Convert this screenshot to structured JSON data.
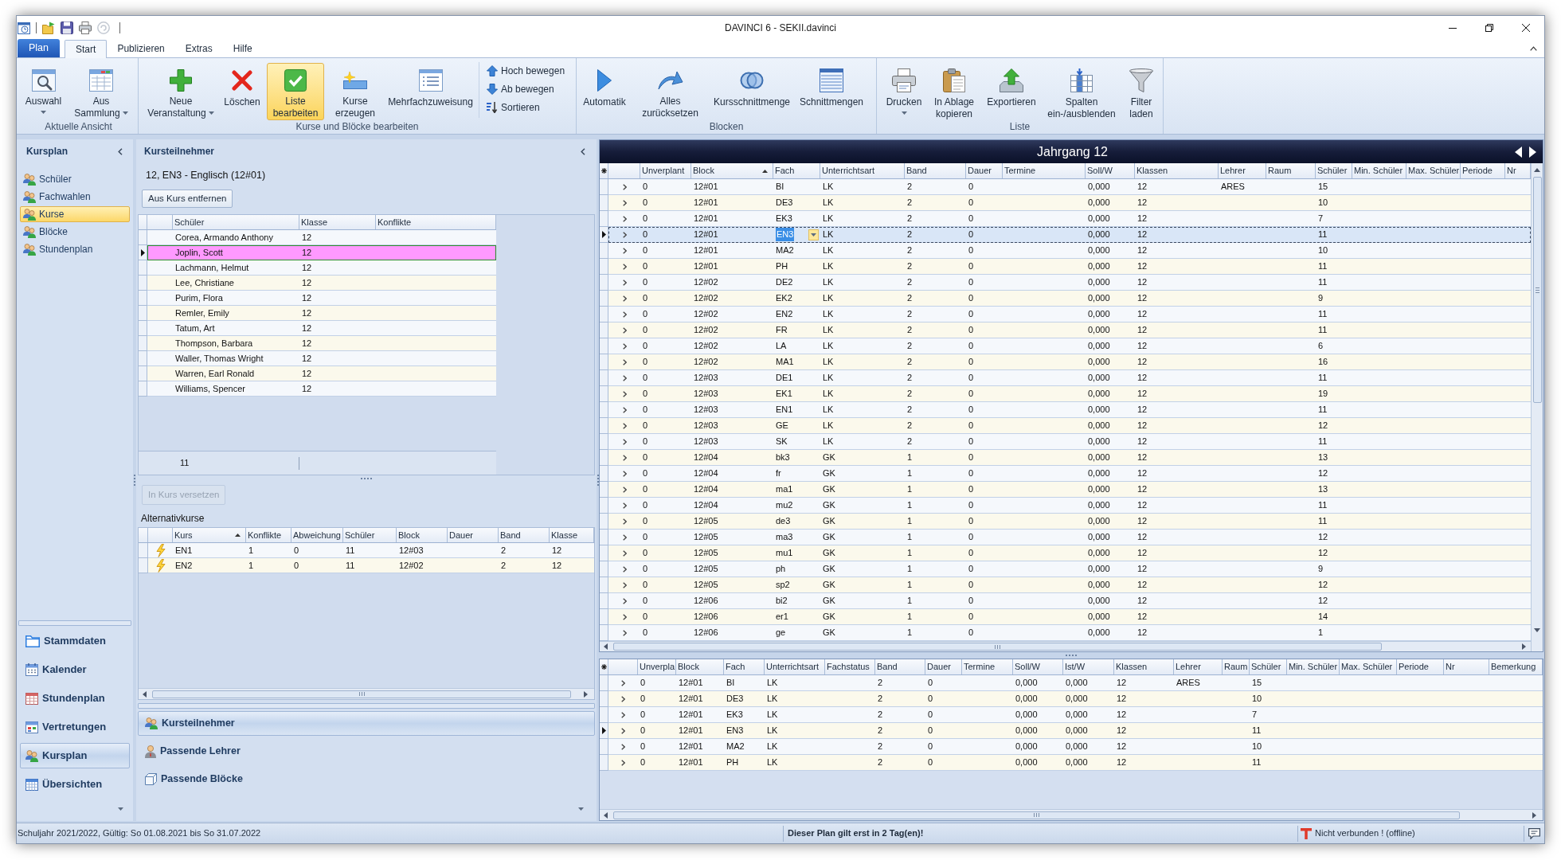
{
  "window": {
    "title": "DAVINCI 6 - SEKII.davinci"
  },
  "ribbon_tabs": [
    {
      "label": "Plan",
      "kind": "application",
      "selected": false
    },
    {
      "label": "Start",
      "kind": "tab",
      "selected": true
    },
    {
      "label": "Publizieren",
      "kind": "tab",
      "selected": false
    },
    {
      "label": "Extras",
      "kind": "tab",
      "selected": false
    },
    {
      "label": "Hilfe",
      "kind": "tab",
      "selected": false
    }
  ],
  "ribbon_groups": [
    {
      "label": "Aktuelle Ansicht",
      "buttons": [
        {
          "kind": "large",
          "lines": [
            "Auswahl"
          ],
          "dropdown": true,
          "pressed": false
        },
        {
          "kind": "large",
          "lines": [
            "Aus",
            "Sammlung"
          ],
          "dropdown": true,
          "pressed": false
        }
      ]
    },
    {
      "label": "Kurse und Blöcke bearbeiten",
      "buttons": [
        {
          "kind": "large",
          "lines": [
            "Neue",
            "Veranstaltung"
          ],
          "dropdown": true,
          "pressed": false
        },
        {
          "kind": "large",
          "lines": [
            "Löschen"
          ],
          "dropdown": false,
          "pressed": false
        },
        {
          "kind": "large",
          "lines": [
            "Liste",
            "bearbeiten"
          ],
          "dropdown": false,
          "pressed": true
        },
        {
          "kind": "large",
          "lines": [
            "Kurse",
            "erzeugen"
          ],
          "dropdown": false,
          "pressed": false
        },
        {
          "kind": "large",
          "lines": [
            "Mehrfachzuweisung"
          ],
          "dropdown": false,
          "pressed": false
        },
        {
          "kind": "small",
          "lines": [
            "Hoch bewegen"
          ],
          "dropdown": false,
          "pressed": false
        },
        {
          "kind": "small",
          "lines": [
            "Ab bewegen"
          ],
          "dropdown": false,
          "pressed": false
        },
        {
          "kind": "small",
          "lines": [
            "Sortieren"
          ],
          "dropdown": false,
          "pressed": false
        }
      ]
    },
    {
      "label": "Blocken",
      "buttons": [
        {
          "kind": "large",
          "lines": [
            "Automatik"
          ],
          "dropdown": false,
          "pressed": false
        },
        {
          "kind": "large",
          "lines": [
            "Alles",
            "zurücksetzen"
          ],
          "dropdown": false,
          "pressed": false
        },
        {
          "kind": "large",
          "lines": [
            "Kursschnittmenge"
          ],
          "dropdown": false,
          "pressed": false
        },
        {
          "kind": "large",
          "lines": [
            "Schnittmengen"
          ],
          "dropdown": false,
          "pressed": false
        }
      ]
    },
    {
      "label": "Liste",
      "buttons": [
        {
          "kind": "large",
          "lines": [
            "Drucken"
          ],
          "dropdown": true,
          "pressed": false
        },
        {
          "kind": "large",
          "lines": [
            "In Ablage",
            "kopieren"
          ],
          "dropdown": false,
          "pressed": false
        },
        {
          "kind": "large",
          "lines": [
            "Exportieren"
          ],
          "dropdown": false,
          "pressed": false
        },
        {
          "kind": "large",
          "lines": [
            "Spalten",
            "ein-/ausblenden"
          ],
          "dropdown": false,
          "pressed": false
        },
        {
          "kind": "large",
          "lines": [
            "Filter",
            "laden"
          ],
          "dropdown": false,
          "pressed": false
        }
      ]
    }
  ],
  "navigator": {
    "title": "Kursplan",
    "items": [
      {
        "label": "Schüler",
        "selected": false
      },
      {
        "label": "Fachwahlen",
        "selected": false
      },
      {
        "label": "Kurse",
        "selected": true
      },
      {
        "label": "Blöcke",
        "selected": false
      },
      {
        "label": "Stundenplan",
        "selected": false
      }
    ]
  },
  "modules": [
    {
      "label": "Stammdaten",
      "selected": false
    },
    {
      "label": "Kalender",
      "selected": false
    },
    {
      "label": "Stundenplan",
      "selected": false
    },
    {
      "label": "Vertretungen",
      "selected": false
    },
    {
      "label": "Kursplan",
      "selected": true
    },
    {
      "label": "Übersichten",
      "selected": false
    }
  ],
  "participants_panel": {
    "title": "Kursteilnehmer",
    "course": "12, EN3 - Englisch (12#01)",
    "remove_button": {
      "label": "Aus Kurs entfernen",
      "disabled": false
    },
    "table": {
      "columns": [
        {
          "label": "Schüler"
        },
        {
          "label": "Klasse"
        },
        {
          "label": "Konflikte"
        }
      ],
      "rows": [
        {
          "schueler": "Corea, Armando Anthony",
          "klasse": "12",
          "selected": false
        },
        {
          "schueler": "Joplin, Scott",
          "klasse": "12",
          "selected": true
        },
        {
          "schueler": "Lachmann, Helmut",
          "klasse": "12",
          "selected": false
        },
        {
          "schueler": "Lee, Christiane",
          "klasse": "12",
          "selected": false
        },
        {
          "schueler": "Purim, Flora",
          "klasse": "12",
          "selected": false
        },
        {
          "schueler": "Remler, Emily",
          "klasse": "12",
          "selected": false
        },
        {
          "schueler": "Tatum, Art",
          "klasse": "12",
          "selected": false
        },
        {
          "schueler": "Thompson, Barbara",
          "klasse": "12",
          "selected": false
        },
        {
          "schueler": "Waller, Thomas Wright",
          "klasse": "12",
          "selected": false
        },
        {
          "schueler": "Warren, Earl Ronald",
          "klasse": "12",
          "selected": false
        },
        {
          "schueler": "Williams, Spencer",
          "klasse": "12",
          "selected": false
        }
      ],
      "footer": "11"
    },
    "move_button": {
      "label": "In Kurs versetzen",
      "disabled": true
    },
    "alternatives": {
      "title": "Alternativkurse",
      "columns": [
        {
          "label": "Kurs",
          "sorted": true
        },
        {
          "label": "Konflikte",
          "sorted": false
        },
        {
          "label": "Abweichung",
          "sorted": false
        },
        {
          "label": "Schüler",
          "sorted": false
        },
        {
          "label": "Block",
          "sorted": false
        },
        {
          "label": "Dauer",
          "sorted": false
        },
        {
          "label": "Band",
          "sorted": false
        },
        {
          "label": "Klasse",
          "sorted": false
        }
      ],
      "rows": [
        {
          "kurs": "EN1",
          "konflikte": "1",
          "abweichung": "0",
          "schueler": "11",
          "block": "12#03",
          "band": "2",
          "klasse": "12",
          "selected": false
        },
        {
          "kurs": "EN2",
          "konflikte": "1",
          "abweichung": "0",
          "schueler": "11",
          "block": "12#02",
          "band": "2",
          "klasse": "12",
          "selected": false
        }
      ]
    },
    "views": [
      {
        "label": "Kursteilnehmer",
        "selected": true
      },
      {
        "label": "Passende Lehrer",
        "selected": false
      },
      {
        "label": "Passende Blöcke",
        "selected": false
      }
    ]
  },
  "course_grid": {
    "title": "Jahrgang 12",
    "columns": [
      {
        "label": "Unverplant",
        "sorted": false
      },
      {
        "label": "Block",
        "sorted": true
      },
      {
        "label": "Fach",
        "sorted": false
      },
      {
        "label": "Unterrichtsart",
        "sorted": false
      },
      {
        "label": "Band",
        "sorted": false
      },
      {
        "label": "Dauer",
        "sorted": false
      },
      {
        "label": "Termine",
        "sorted": false
      },
      {
        "label": "Soll/W",
        "sorted": false
      },
      {
        "label": "Klassen",
        "sorted": false
      },
      {
        "label": "Lehrer",
        "sorted": false
      },
      {
        "label": "Raum",
        "sorted": false
      },
      {
        "label": "Schüler",
        "sorted": false
      },
      {
        "label": "Min. Schüler",
        "sorted": false
      },
      {
        "label": "Max. Schüler",
        "sorted": false
      },
      {
        "label": "Periode",
        "sorted": false
      },
      {
        "label": "Nr",
        "sorted": false
      }
    ],
    "rows": [
      {
        "unverplant": "0",
        "block": "12#01",
        "fach": "BI",
        "unterrichtsart": "LK",
        "band": "2",
        "dauer": "0",
        "soll_w": "0,000",
        "klassen": "12",
        "lehrer": "ARES",
        "schueler": "15",
        "expanded": false,
        "selected": false
      },
      {
        "unverplant": "0",
        "block": "12#01",
        "fach": "DE3",
        "unterrichtsart": "LK",
        "band": "2",
        "dauer": "0",
        "soll_w": "0,000",
        "klassen": "12",
        "schueler": "10",
        "expanded": false,
        "selected": false
      },
      {
        "unverplant": "0",
        "block": "12#01",
        "fach": "EK3",
        "unterrichtsart": "LK",
        "band": "2",
        "dauer": "0",
        "soll_w": "0,000",
        "klassen": "12",
        "schueler": "7",
        "expanded": false,
        "selected": false
      },
      {
        "unverplant": "0",
        "block": "12#01",
        "fach": "EN3",
        "unterrichtsart": "LK",
        "band": "2",
        "dauer": "0",
        "soll_w": "0,000",
        "klassen": "12",
        "schueler": "11",
        "expanded": false,
        "selected": true
      },
      {
        "unverplant": "0",
        "block": "12#01",
        "fach": "MA2",
        "unterrichtsart": "LK",
        "band": "2",
        "dauer": "0",
        "soll_w": "0,000",
        "klassen": "12",
        "schueler": "10",
        "expanded": false,
        "selected": false
      },
      {
        "unverplant": "0",
        "block": "12#01",
        "fach": "PH",
        "unterrichtsart": "LK",
        "band": "2",
        "dauer": "0",
        "soll_w": "0,000",
        "klassen": "12",
        "schueler": "11",
        "expanded": false,
        "selected": false
      },
      {
        "unverplant": "0",
        "block": "12#02",
        "fach": "DE2",
        "unterrichtsart": "LK",
        "band": "2",
        "dauer": "0",
        "soll_w": "0,000",
        "klassen": "12",
        "schueler": "11",
        "expanded": false,
        "selected": false
      },
      {
        "unverplant": "0",
        "block": "12#02",
        "fach": "EK2",
        "unterrichtsart": "LK",
        "band": "2",
        "dauer": "0",
        "soll_w": "0,000",
        "klassen": "12",
        "schueler": "9",
        "expanded": false,
        "selected": false
      },
      {
        "unverplant": "0",
        "block": "12#02",
        "fach": "EN2",
        "unterrichtsart": "LK",
        "band": "2",
        "dauer": "0",
        "soll_w": "0,000",
        "klassen": "12",
        "schueler": "11",
        "expanded": false,
        "selected": false
      },
      {
        "unverplant": "0",
        "block": "12#02",
        "fach": "FR",
        "unterrichtsart": "LK",
        "band": "2",
        "dauer": "0",
        "soll_w": "0,000",
        "klassen": "12",
        "schueler": "11",
        "expanded": false,
        "selected": false
      },
      {
        "unverplant": "0",
        "block": "12#02",
        "fach": "LA",
        "unterrichtsart": "LK",
        "band": "2",
        "dauer": "0",
        "soll_w": "0,000",
        "klassen": "12",
        "schueler": "6",
        "expanded": false,
        "selected": false
      },
      {
        "unverplant": "0",
        "block": "12#02",
        "fach": "MA1",
        "unterrichtsart": "LK",
        "band": "2",
        "dauer": "0",
        "soll_w": "0,000",
        "klassen": "12",
        "schueler": "16",
        "expanded": false,
        "selected": false
      },
      {
        "unverplant": "0",
        "block": "12#03",
        "fach": "DE1",
        "unterrichtsart": "LK",
        "band": "2",
        "dauer": "0",
        "soll_w": "0,000",
        "klassen": "12",
        "schueler": "11",
        "expanded": false,
        "selected": false
      },
      {
        "unverplant": "0",
        "block": "12#03",
        "fach": "EK1",
        "unterrichtsart": "LK",
        "band": "2",
        "dauer": "0",
        "soll_w": "0,000",
        "klassen": "12",
        "schueler": "19",
        "expanded": false,
        "selected": false
      },
      {
        "unverplant": "0",
        "block": "12#03",
        "fach": "EN1",
        "unterrichtsart": "LK",
        "band": "2",
        "dauer": "0",
        "soll_w": "0,000",
        "klassen": "12",
        "schueler": "11",
        "expanded": false,
        "selected": false
      },
      {
        "unverplant": "0",
        "block": "12#03",
        "fach": "GE",
        "unterrichtsart": "LK",
        "band": "2",
        "dauer": "0",
        "soll_w": "0,000",
        "klassen": "12",
        "schueler": "12",
        "expanded": false,
        "selected": false
      },
      {
        "unverplant": "0",
        "block": "12#03",
        "fach": "SK",
        "unterrichtsart": "LK",
        "band": "2",
        "dauer": "0",
        "soll_w": "0,000",
        "klassen": "12",
        "schueler": "11",
        "expanded": false,
        "selected": false
      },
      {
        "unverplant": "0",
        "block": "12#04",
        "fach": "bk3",
        "unterrichtsart": "GK",
        "band": "1",
        "dauer": "0",
        "soll_w": "0,000",
        "klassen": "12",
        "schueler": "13",
        "expanded": false,
        "selected": false
      },
      {
        "unverplant": "0",
        "block": "12#04",
        "fach": "fr",
        "unterrichtsart": "GK",
        "band": "1",
        "dauer": "0",
        "soll_w": "0,000",
        "klassen": "12",
        "schueler": "12",
        "expanded": false,
        "selected": false
      },
      {
        "unverplant": "0",
        "block": "12#04",
        "fach": "ma1",
        "unterrichtsart": "GK",
        "band": "1",
        "dauer": "0",
        "soll_w": "0,000",
        "klassen": "12",
        "schueler": "13",
        "expanded": false,
        "selected": false
      },
      {
        "unverplant": "0",
        "block": "12#04",
        "fach": "mu2",
        "unterrichtsart": "GK",
        "band": "1",
        "dauer": "0",
        "soll_w": "0,000",
        "klassen": "12",
        "schueler": "11",
        "expanded": false,
        "selected": false
      },
      {
        "unverplant": "0",
        "block": "12#05",
        "fach": "de3",
        "unterrichtsart": "GK",
        "band": "1",
        "dauer": "0",
        "soll_w": "0,000",
        "klassen": "12",
        "schueler": "11",
        "expanded": false,
        "selected": false
      },
      {
        "unverplant": "0",
        "block": "12#05",
        "fach": "ma3",
        "unterrichtsart": "GK",
        "band": "1",
        "dauer": "0",
        "soll_w": "0,000",
        "klassen": "12",
        "schueler": "12",
        "expanded": false,
        "selected": false
      },
      {
        "unverplant": "0",
        "block": "12#05",
        "fach": "mu1",
        "unterrichtsart": "GK",
        "band": "1",
        "dauer": "0",
        "soll_w": "0,000",
        "klassen": "12",
        "schueler": "12",
        "expanded": false,
        "selected": false
      },
      {
        "unverplant": "0",
        "block": "12#05",
        "fach": "ph",
        "unterrichtsart": "GK",
        "band": "1",
        "dauer": "0",
        "soll_w": "0,000",
        "klassen": "12",
        "schueler": "9",
        "expanded": false,
        "selected": false
      },
      {
        "unverplant": "0",
        "block": "12#05",
        "fach": "sp2",
        "unterrichtsart": "GK",
        "band": "1",
        "dauer": "0",
        "soll_w": "0,000",
        "klassen": "12",
        "schueler": "12",
        "expanded": false,
        "selected": false
      },
      {
        "unverplant": "0",
        "block": "12#06",
        "fach": "bi2",
        "unterrichtsart": "GK",
        "band": "1",
        "dauer": "0",
        "soll_w": "0,000",
        "klassen": "12",
        "schueler": "12",
        "expanded": false,
        "selected": false
      },
      {
        "unverplant": "0",
        "block": "12#06",
        "fach": "er1",
        "unterrichtsart": "GK",
        "band": "1",
        "dauer": "0",
        "soll_w": "0,000",
        "klassen": "12",
        "schueler": "14",
        "expanded": false,
        "selected": false
      },
      {
        "unverplant": "0",
        "block": "12#06",
        "fach": "ge",
        "unterrichtsart": "GK",
        "band": "1",
        "dauer": "0",
        "soll_w": "0,000",
        "klassen": "12",
        "schueler": "1",
        "expanded": false,
        "selected": false
      }
    ]
  },
  "block_grid": {
    "columns": [
      {
        "label": "Unverpla"
      },
      {
        "label": "Block"
      },
      {
        "label": "Fach"
      },
      {
        "label": "Unterrichtsart"
      },
      {
        "label": "Fachstatus"
      },
      {
        "label": "Band"
      },
      {
        "label": "Dauer"
      },
      {
        "label": "Termine"
      },
      {
        "label": "Soll/W"
      },
      {
        "label": "Ist/W"
      },
      {
        "label": "Klassen"
      },
      {
        "label": "Lehrer"
      },
      {
        "label": "Raum"
      },
      {
        "label": "Schüler"
      },
      {
        "label": "Min. Schüler"
      },
      {
        "label": "Max. Schüler"
      },
      {
        "label": "Periode"
      },
      {
        "label": "Nr"
      },
      {
        "label": "Bemerkung"
      }
    ],
    "rows": [
      {
        "unverplant": "0",
        "block": "12#01",
        "fach": "BI",
        "unterrichtsart": "LK",
        "band": "2",
        "dauer": "0",
        "soll_w": "0,000",
        "ist_w": "0,000",
        "klassen": "12",
        "lehrer": "ARES",
        "schueler": "15",
        "expanded": false,
        "selected": false
      },
      {
        "unverplant": "0",
        "block": "12#01",
        "fach": "DE3",
        "unterrichtsart": "LK",
        "band": "2",
        "dauer": "0",
        "soll_w": "0,000",
        "ist_w": "0,000",
        "klassen": "12",
        "schueler": "10",
        "expanded": false,
        "selected": false
      },
      {
        "unverplant": "0",
        "block": "12#01",
        "fach": "EK3",
        "unterrichtsart": "LK",
        "band": "2",
        "dauer": "0",
        "soll_w": "0,000",
        "ist_w": "0,000",
        "klassen": "12",
        "schueler": "7",
        "expanded": false,
        "selected": false
      },
      {
        "unverplant": "0",
        "block": "12#01",
        "fach": "EN3",
        "unterrichtsart": "LK",
        "band": "2",
        "dauer": "0",
        "soll_w": "0,000",
        "ist_w": "0,000",
        "klassen": "12",
        "schueler": "11",
        "expanded": false,
        "selected": true
      },
      {
        "unverplant": "0",
        "block": "12#01",
        "fach": "MA2",
        "unterrichtsart": "LK",
        "band": "2",
        "dauer": "0",
        "soll_w": "0,000",
        "ist_w": "0,000",
        "klassen": "12",
        "schueler": "10",
        "expanded": false,
        "selected": false
      },
      {
        "unverplant": "0",
        "block": "12#01",
        "fach": "PH",
        "unterrichtsart": "LK",
        "band": "2",
        "dauer": "0",
        "soll_w": "0,000",
        "ist_w": "0,000",
        "klassen": "12",
        "schueler": "11",
        "expanded": false,
        "selected": false
      }
    ]
  },
  "status_bar": {
    "school_year": "Schuljahr 2021/2022, Gültig: So 01.08.2021 bis So 31.07.2022",
    "notice": "Dieser Plan gilt erst in 2 Tag(en)!",
    "connection": "Nicht verbunden ! (offline)"
  }
}
